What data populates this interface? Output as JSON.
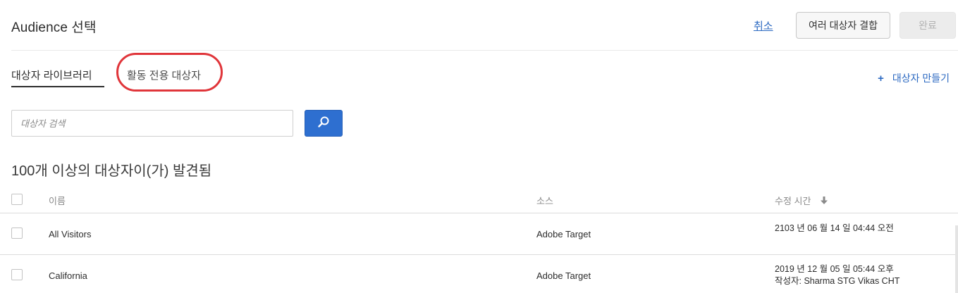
{
  "header": {
    "title": "Audience 선택",
    "cancel_label": "취소",
    "combine_label": "여러 대상자 결합",
    "done_label": "완료"
  },
  "tabs": [
    {
      "label": "대상자 라이브러리",
      "active": true
    },
    {
      "label": "활동 전용 대상자",
      "active": false,
      "highlighted": true
    }
  ],
  "create_audience": {
    "icon": "plus-icon",
    "label": "대상자 만들기"
  },
  "search": {
    "placeholder": "대상자 검색",
    "value": "",
    "button_icon": "search-icon"
  },
  "results": {
    "count_text": "100개 이상의 대상자이(가) 발견됨"
  },
  "table": {
    "columns": {
      "name": "이름",
      "source": "소스",
      "modified": "수정 시간",
      "sort_icon": "arrow-down-icon"
    },
    "rows": [
      {
        "name": "All Visitors",
        "source": "Adobe Target",
        "modified": "2103 년 06 월 14 일  04:44 오전",
        "author": ""
      },
      {
        "name": "California",
        "source": "Adobe Target",
        "modified": "2019 년 12 월 05 일  05:44 오후",
        "author": "작성자: Sharma STG Vikas CHT"
      }
    ]
  },
  "colors": {
    "accent": "#2d6ac2",
    "search_button": "#2e6fd0",
    "highlight": "#e0353a",
    "text": "#2c2c2c",
    "muted": "#8a8a8a"
  }
}
